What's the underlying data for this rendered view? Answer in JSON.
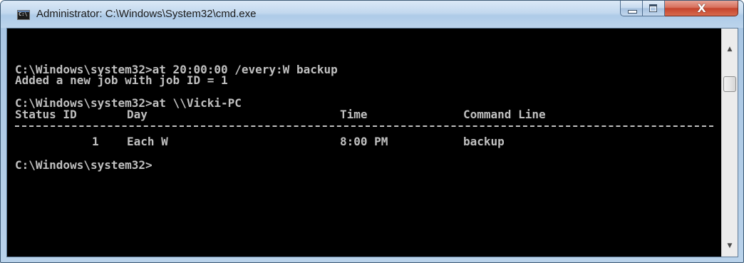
{
  "window": {
    "title": "Administrator: C:\\Windows\\System32\\cmd.exe",
    "icon_label": "C:\\",
    "close_glyph": "X"
  },
  "console": {
    "lines": [
      "C:\\Windows\\system32>at 20:00:00 /every:W backup",
      "Added a new job with job ID = 1",
      "C:\\Windows\\system32>at \\\\Vicki-PC"
    ],
    "table": {
      "headers": [
        "Status ID",
        "Day",
        "Time",
        "Command Line"
      ],
      "rows": [
        {
          "id": "1",
          "day": "Each W",
          "time": "8:00 PM",
          "command": "backup"
        }
      ]
    },
    "prompt": "C:\\Windows\\system32>"
  },
  "scrollbar": {
    "up_glyph": "▲",
    "down_glyph": "▼"
  },
  "colors": {
    "console_bg": "#000000",
    "console_text": "#c0c0c0",
    "close_button": "#c5452d"
  }
}
